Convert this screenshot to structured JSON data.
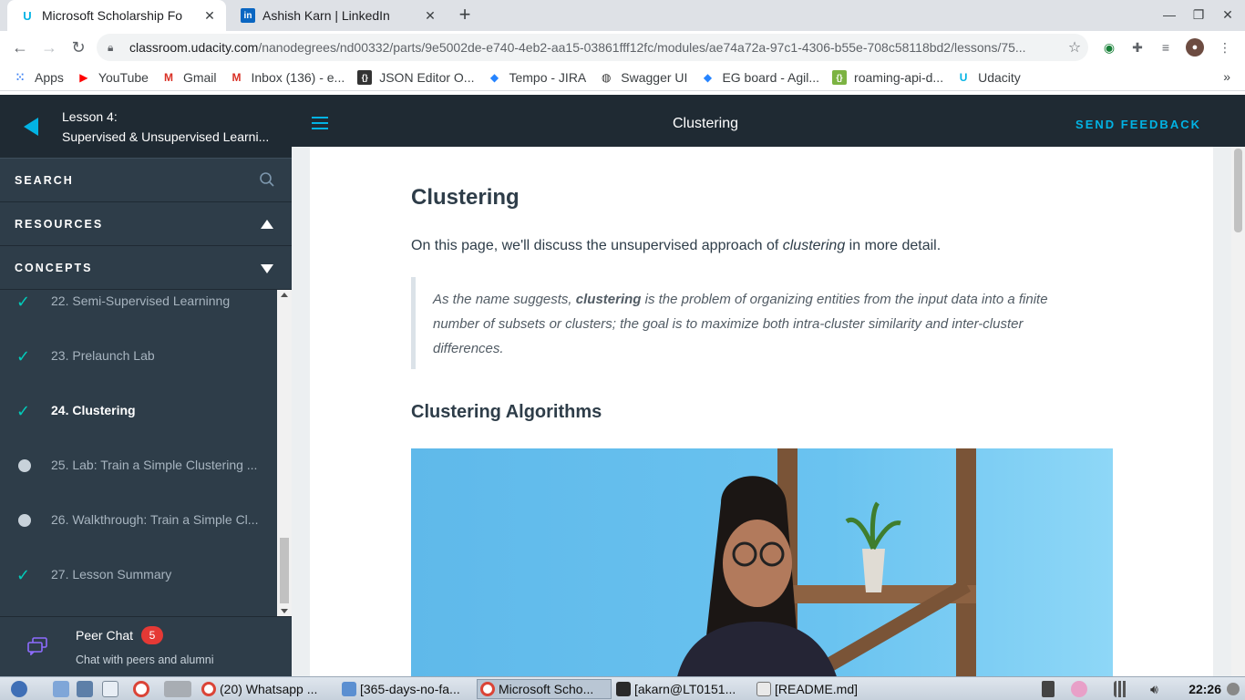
{
  "browser": {
    "tabs": [
      {
        "title": "Microsoft Scholarship Fo",
        "icon": "udacity-icon"
      },
      {
        "title": "Ashish Karn | LinkedIn",
        "icon": "linkedin-icon"
      }
    ],
    "url_host": "classroom.udacity.com",
    "url_path": "/nanodegrees/nd00332/parts/9e5002de-e740-4eb2-aa15-03861fff12fc/modules/ae74a72a-97c1-4306-b55e-708c58118bd2/lessons/75...",
    "bookmarks": [
      {
        "label": "Apps",
        "icon": "apps-grid-icon",
        "color": "#4285f4"
      },
      {
        "label": "YouTube",
        "icon": "youtube-icon",
        "color": "#ff0000"
      },
      {
        "label": "Gmail",
        "icon": "gmail-icon",
        "color": "#d93025"
      },
      {
        "label": "Inbox (136) - e...",
        "icon": "gmail-icon",
        "color": "#d93025"
      },
      {
        "label": "JSON Editor O...",
        "icon": "json-icon",
        "color": "#333333"
      },
      {
        "label": "Tempo - JIRA",
        "icon": "jira-icon",
        "color": "#2684ff"
      },
      {
        "label": "Swagger UI",
        "icon": "swagger-icon",
        "color": "#333333"
      },
      {
        "label": "EG board - Agil...",
        "icon": "jira-icon",
        "color": "#2684ff"
      },
      {
        "label": "roaming-api-d...",
        "icon": "api-doc-icon",
        "color": "#4caf50"
      },
      {
        "label": "Udacity",
        "icon": "udacity-icon",
        "color": "#02b3e4"
      }
    ]
  },
  "sidebar": {
    "lesson_number": "Lesson 4:",
    "lesson_title": "Supervised & Unsupervised Learni...",
    "search_label": "SEARCH",
    "resources_label": "RESOURCES",
    "concepts_label": "CONCEPTS",
    "concepts": [
      {
        "label": "22. Semi-Supervised Learninng",
        "status": "done"
      },
      {
        "label": "23. Prelaunch Lab",
        "status": "done"
      },
      {
        "label": "24. Clustering",
        "status": "current"
      },
      {
        "label": "25. Lab: Train a Simple Clustering ...",
        "status": "todo"
      },
      {
        "label": "26. Walkthrough: Train a Simple Cl...",
        "status": "todo"
      },
      {
        "label": "27. Lesson Summary",
        "status": "done"
      }
    ],
    "peer_chat": {
      "title": "Peer Chat",
      "badge": "5",
      "subtitle": "Chat with peers and alumni"
    }
  },
  "header": {
    "title": "Clustering",
    "feedback": "SEND FEEDBACK"
  },
  "content": {
    "heading": "Clustering",
    "intro_before": "On this page, we'll discuss the unsupervised approach of ",
    "intro_em": "clustering",
    "intro_after": " in more detail.",
    "quote_before": "As the name suggests, ",
    "quote_bold": "clustering",
    "quote_after": " is the problem of organizing entities from the input data into a finite number of subsets or clusters; the goal is to maximize both intra-cluster similarity and inter-cluster differences.",
    "subheading": "Clustering Algorithms"
  },
  "taskbar": {
    "items": [
      "(20) Whatsapp ...",
      "[365-days-no-fa...",
      "Microsoft Scho...",
      "[akarn@LT0151...",
      "[README.md]"
    ],
    "clock": "22:26"
  },
  "colors": {
    "accent": "#02b3e4",
    "check": "#02ccba",
    "sidebar_bg": "#2e3d49",
    "header_bg": "#1f2a33"
  }
}
